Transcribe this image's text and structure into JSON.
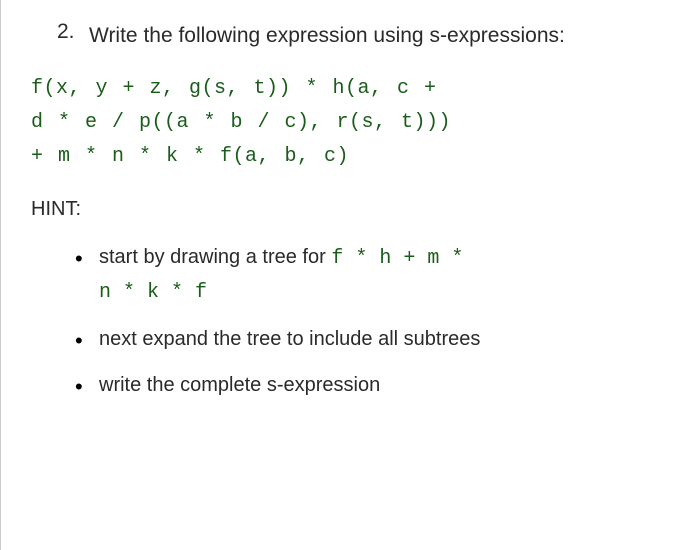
{
  "question": {
    "number": "2.",
    "prompt": "Write the following expression using s-expressions:"
  },
  "code": {
    "line1": "f(x, y + z, g(s, t)) * h(a, c +",
    "line2": "d * e / p((a * b / c), r(s, t)))",
    "line3": "+ m * n * k * f(a, b, c)"
  },
  "hint": {
    "label": "HINT:",
    "items": [
      {
        "prefix": "start by drawing a tree for ",
        "code1": "f * h + m *",
        "code2": "n * k * f"
      },
      {
        "text": "next expand the tree to include all subtrees"
      },
      {
        "text": "write the complete s-expression"
      }
    ]
  }
}
